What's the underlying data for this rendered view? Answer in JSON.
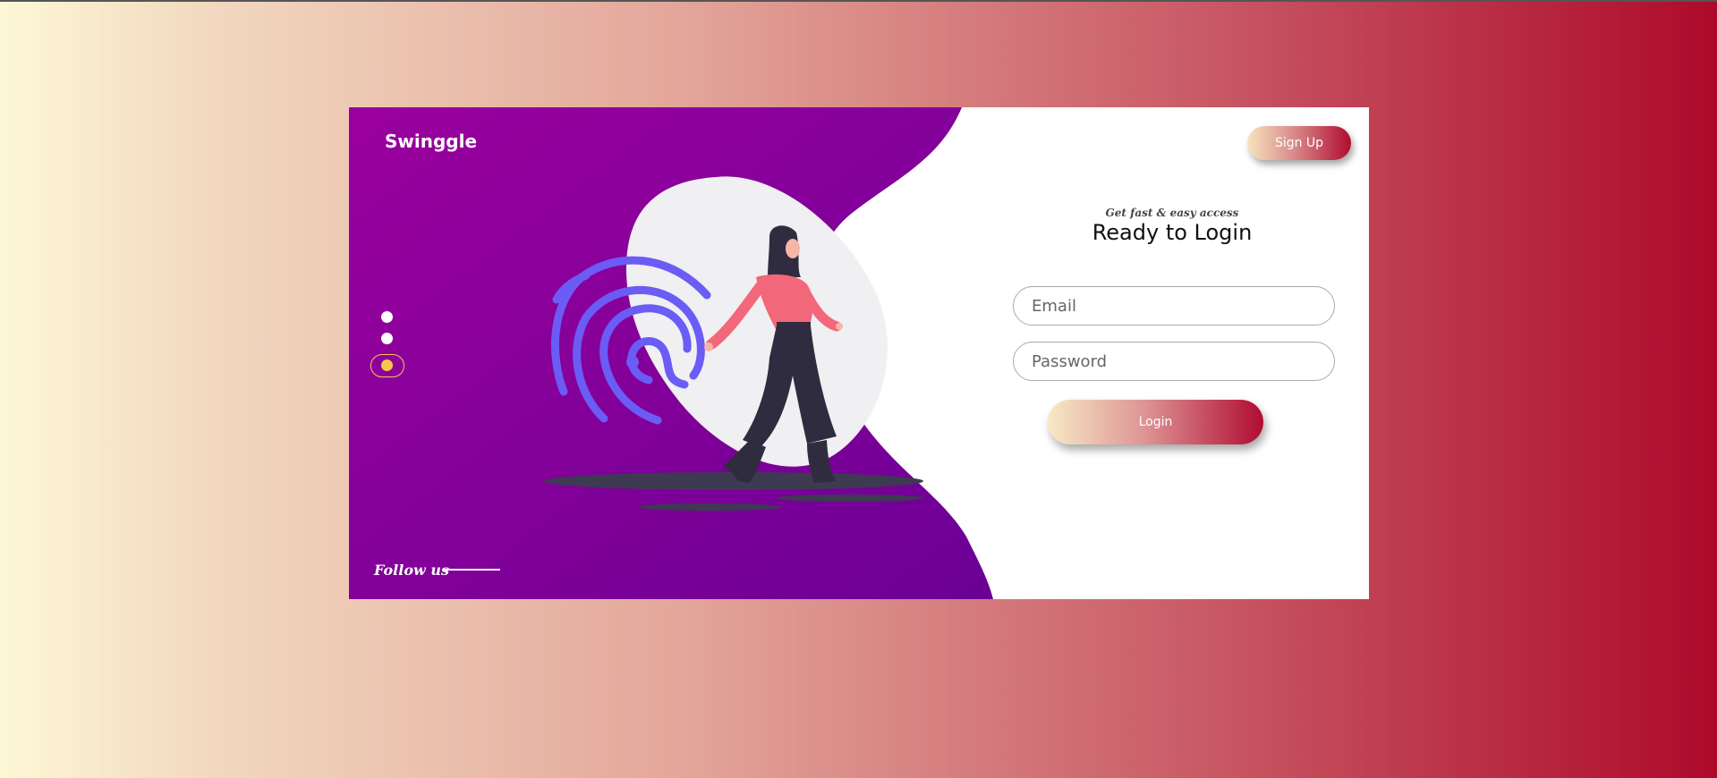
{
  "brand": {
    "name": "Swinggle"
  },
  "header": {
    "signup_label": "Sign Up"
  },
  "carousel": {
    "slides": 3,
    "active_slide": 3
  },
  "social": {
    "follow_label": "Follow us"
  },
  "login": {
    "subtitle": "Get fast & easy access",
    "title": "Ready to Login",
    "email_placeholder": "Email",
    "password_placeholder": "Password",
    "submit_label": "Login"
  },
  "illustration": {
    "icons": [
      "fingerprint-icon",
      "woman-walking-illustration"
    ]
  },
  "colors": {
    "page_gradient_start": "#fdf8d6",
    "page_gradient_end": "#ad0a2a",
    "panel_purple": "#9b009e",
    "panel_purple_dark": "#6b0095",
    "accent_yellow": "#f3c94a",
    "fingerprint": "#6b5cf5",
    "shirt_pink": "#f2677a"
  }
}
